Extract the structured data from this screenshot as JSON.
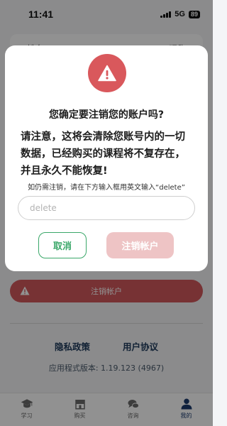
{
  "status_bar": {
    "time": "11:41",
    "network": "5G",
    "battery": "89"
  },
  "background": {
    "top_card": {
      "left_label": "姓名",
      "right_label": "昵称"
    },
    "delete_account_button": "注销帐户",
    "links": {
      "privacy": "隐私政策",
      "agreement": "用户协议"
    },
    "version": "应用程式版本: 1.19.123 (4967)"
  },
  "tabbar": {
    "items": [
      {
        "label": "学习",
        "icon": "graduation-cap-icon"
      },
      {
        "label": "购买",
        "icon": "store-icon"
      },
      {
        "label": "咨询",
        "icon": "chat-bubbles-icon"
      },
      {
        "label": "我的",
        "icon": "person-icon"
      }
    ],
    "active_index": 3
  },
  "modal": {
    "icon": "warning-triangle-icon",
    "title": "您确定要注销您的账户吗?",
    "warning": "请注意，这将会清除您账号内的一切数据，已经购买的课程将不复存在，并且永久不能恢复!",
    "hint": "如仍需注销，请在下方输入框用英文输入“delete”",
    "input_value": "",
    "input_placeholder": "delete",
    "cancel_label": "取消",
    "confirm_label": "注销帐户"
  },
  "colors": {
    "danger": "#d9585c",
    "danger_disabled": "#eec4c5",
    "cancel_green": "#3aa769",
    "link_navy": "#1f3a5c"
  }
}
